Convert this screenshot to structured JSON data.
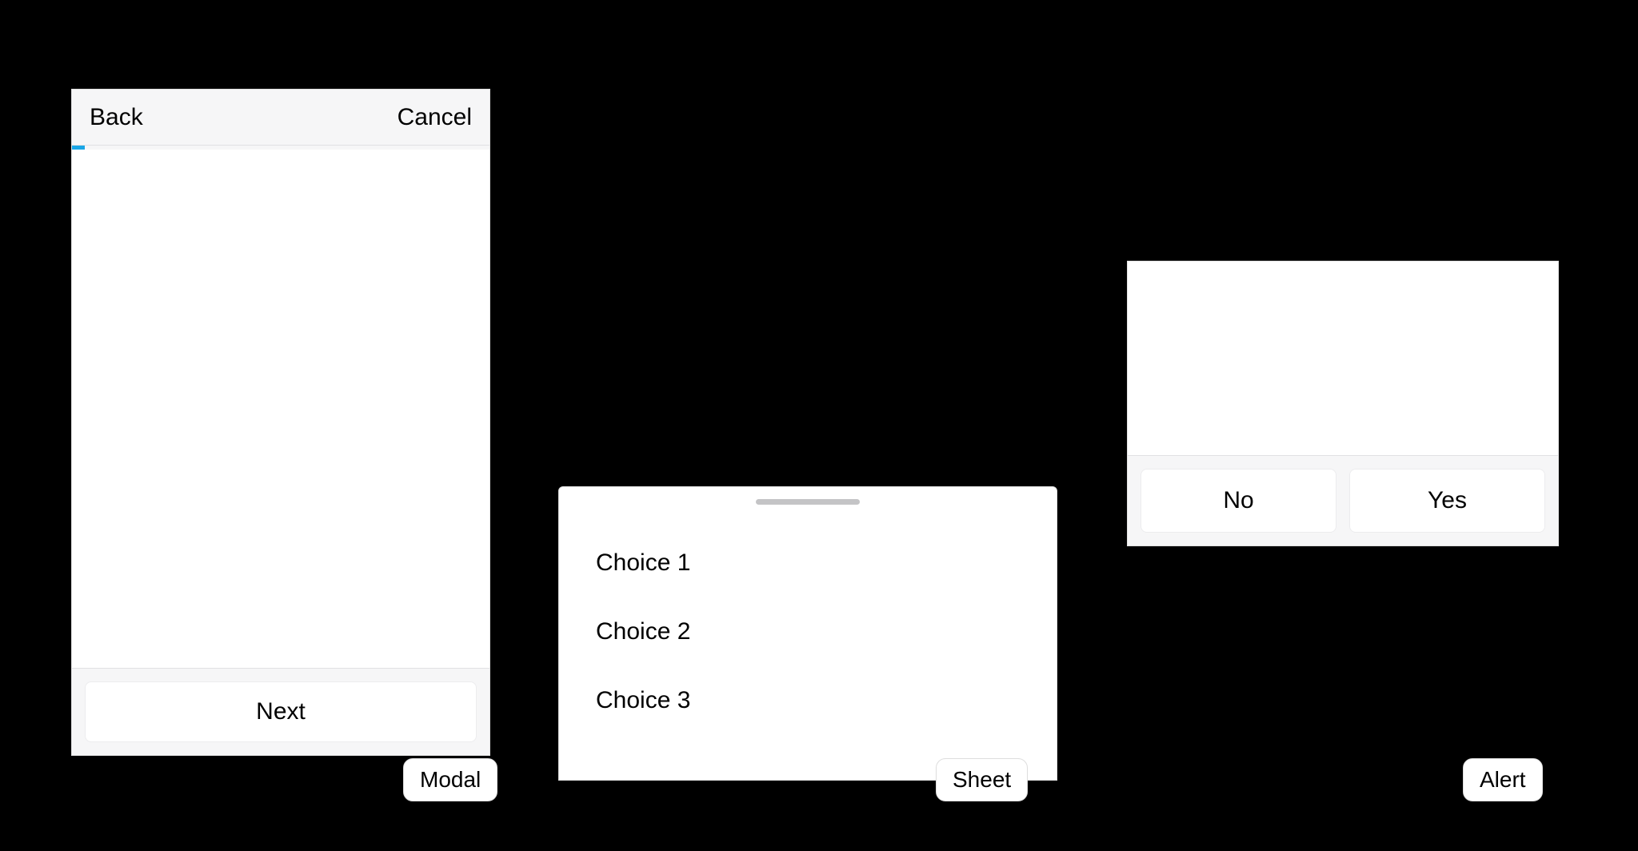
{
  "modal": {
    "back_label": "Back",
    "cancel_label": "Cancel",
    "next_label": "Next",
    "tag": "Modal"
  },
  "sheet": {
    "items": [
      {
        "label": "Choice 1"
      },
      {
        "label": "Choice 2"
      },
      {
        "label": "Choice 3"
      }
    ],
    "tag": "Sheet"
  },
  "alert": {
    "no_label": "No",
    "yes_label": "Yes",
    "tag": "Alert"
  }
}
